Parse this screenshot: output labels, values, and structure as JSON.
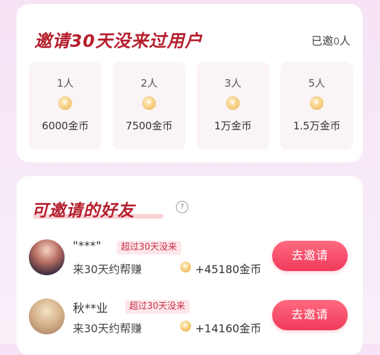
{
  "top_card": {
    "title": "邀请30天没来过用户",
    "invited_prefix": "已邀",
    "invited_num": "0",
    "invited_suffix": "人",
    "tiers": [
      {
        "people": "1人",
        "reward": "6000金币"
      },
      {
        "people": "2人",
        "reward": "7500金币"
      },
      {
        "people": "3人",
        "reward": "1万金币"
      },
      {
        "people": "5人",
        "reward": "1.5万金币"
      }
    ],
    "coin_glyph": "¥"
  },
  "friends_card": {
    "title": "可邀请的好友",
    "help_glyph": "?",
    "friends": [
      {
        "name": "\"***\"",
        "tag": "超过30天没来",
        "earn_label": "来30天约帮赚",
        "earn_amount": "+45180金币",
        "button": "去邀请"
      },
      {
        "name": "秋**业",
        "tag": "超过30天没来",
        "earn_label": "来30天约帮赚",
        "earn_amount": "+14160金币",
        "button": "去邀请"
      }
    ]
  },
  "colors": {
    "title_red": "#b51e2c",
    "button_pink": "#f03a5c",
    "tag_bg": "#fde7ea"
  },
  "icons": {
    "coin": "coin-icon",
    "help": "help-circle-icon"
  }
}
